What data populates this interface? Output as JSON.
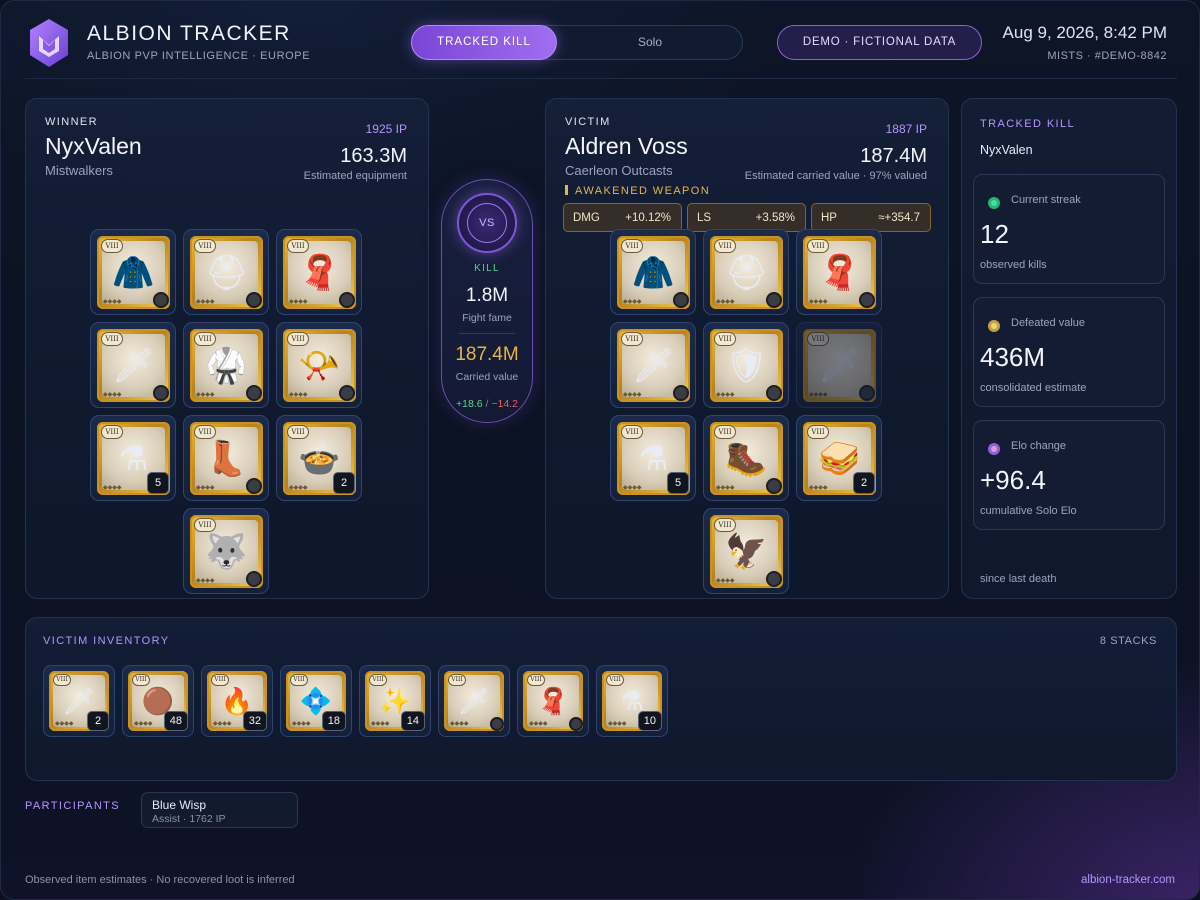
{
  "brand": {
    "title": "ALBION TRACKER",
    "subtitle": "ALBION PVP INTELLIGENCE · EUROPE"
  },
  "header": {
    "tabs": [
      {
        "label": "TRACKED KILL",
        "active": true
      },
      {
        "label": "Solo",
        "active": false
      }
    ],
    "demo_label": "DEMO · FICTIONAL DATA",
    "datetime": "Aug 9, 2026, 8:42 PM",
    "location": "MISTS · #DEMO-8842"
  },
  "winner": {
    "eyebrow": "WINNER",
    "name": "NyxValen",
    "guild": "Mistwalkers",
    "ip": "1925 IP",
    "value": "163.3M",
    "value_label": "Estimated equipment",
    "items": [
      {
        "icon": "hood-icon",
        "glyph": "🧥",
        "count": ""
      },
      {
        "icon": "helmet-icon",
        "glyph": "⛑",
        "count": ""
      },
      {
        "icon": "cape-icon",
        "glyph": "🧣",
        "count": ""
      },
      {
        "icon": "staff-icon",
        "glyph": "🗡",
        "count": ""
      },
      {
        "icon": "armor-icon",
        "glyph": "🥋",
        "count": ""
      },
      {
        "icon": "horn-icon",
        "glyph": "📯",
        "count": ""
      },
      {
        "icon": "potion-icon",
        "glyph": "⚗",
        "count": "5"
      },
      {
        "icon": "boots-icon",
        "glyph": "👢",
        "count": ""
      },
      {
        "icon": "food-icon",
        "glyph": "🍲",
        "count": "2"
      },
      {
        "icon": "mount-icon",
        "glyph": "🐺",
        "count": ""
      }
    ]
  },
  "victim": {
    "eyebrow": "VICTIM",
    "name": "Aldren Voss",
    "guild": "Caerleon Outcasts",
    "ip": "1887 IP",
    "value": "187.4M",
    "value_label": "Estimated carried value · 97% valued",
    "awakened_label": "AWAKENED WEAPON",
    "awakened_stats": [
      {
        "key": "DMG",
        "value": "+10.12%"
      },
      {
        "key": "LS",
        "value": "+3.58%"
      },
      {
        "key": "HP",
        "value": "≈+354.7"
      }
    ],
    "items": [
      {
        "icon": "hood-icon",
        "glyph": "🧥",
        "count": ""
      },
      {
        "icon": "helmet-icon",
        "glyph": "⛑",
        "count": ""
      },
      {
        "icon": "cape-icon",
        "glyph": "🧣",
        "count": ""
      },
      {
        "icon": "sword-icon",
        "glyph": "🗡",
        "count": ""
      },
      {
        "icon": "armor-icon",
        "glyph": "🛡",
        "count": ""
      },
      {
        "icon": "offhand-icon",
        "glyph": "🗡",
        "count": "",
        "ghost": true
      },
      {
        "icon": "potion-icon",
        "glyph": "⚗",
        "count": "5"
      },
      {
        "icon": "boots-icon",
        "glyph": "🥾",
        "count": ""
      },
      {
        "icon": "food-icon",
        "glyph": "🥪",
        "count": "2"
      },
      {
        "icon": "mount-icon",
        "glyph": "🦅",
        "count": ""
      }
    ]
  },
  "fight": {
    "vs": "VS",
    "result": "KILL",
    "fame": "1.8M",
    "fame_label": "Fight fame",
    "carried": "187.4M",
    "carried_label": "Carried value",
    "elo_gain": "+18.6",
    "elo_sep": "/",
    "elo_loss": "−14.2"
  },
  "tracked": {
    "eyebrow": "TRACKED KILL",
    "name": "NyxValen",
    "cards": [
      {
        "label": "Current streak",
        "value": "12",
        "sub": "observed kills",
        "dot_color": "#2fcf7a"
      },
      {
        "label": "Defeated value",
        "value": "436M",
        "sub": "consolidated estimate",
        "dot_color": "#e9b34a"
      },
      {
        "label": "Elo change",
        "value": "+96.4",
        "sub": "cumulative Solo Elo",
        "dot_color": "#a56ef0"
      }
    ],
    "since": "since last death"
  },
  "inventory": {
    "eyebrow": "VICTIM INVENTORY",
    "count_label": "8 STACKS",
    "items": [
      {
        "icon": "greatsword-icon",
        "glyph": "🗡",
        "count": "2"
      },
      {
        "icon": "leather-icon",
        "glyph": "🟤",
        "count": "48"
      },
      {
        "icon": "ember-icon",
        "glyph": "🔥",
        "count": "32"
      },
      {
        "icon": "rune-icon",
        "glyph": "💠",
        "count": "18"
      },
      {
        "icon": "soul-icon",
        "glyph": "✨",
        "count": "14"
      },
      {
        "icon": "spear-icon",
        "glyph": "🗡",
        "count": ""
      },
      {
        "icon": "cape-icon",
        "glyph": "🧣",
        "count": ""
      },
      {
        "icon": "potion-icon",
        "glyph": "⚗",
        "count": "10"
      }
    ]
  },
  "participants": {
    "label": "PARTICIPANTS",
    "list": [
      {
        "name": "Blue Wisp",
        "detail": "Assist · 1762 IP"
      }
    ]
  },
  "footer": {
    "note": "Observed item estimates · No recovered loot is inferred",
    "site": "albion-tracker.com"
  },
  "colors": {
    "accent": "#a06ef0",
    "gold": "#e9b34a",
    "positive": "#59d28a",
    "negative": "#ef5d6b"
  }
}
